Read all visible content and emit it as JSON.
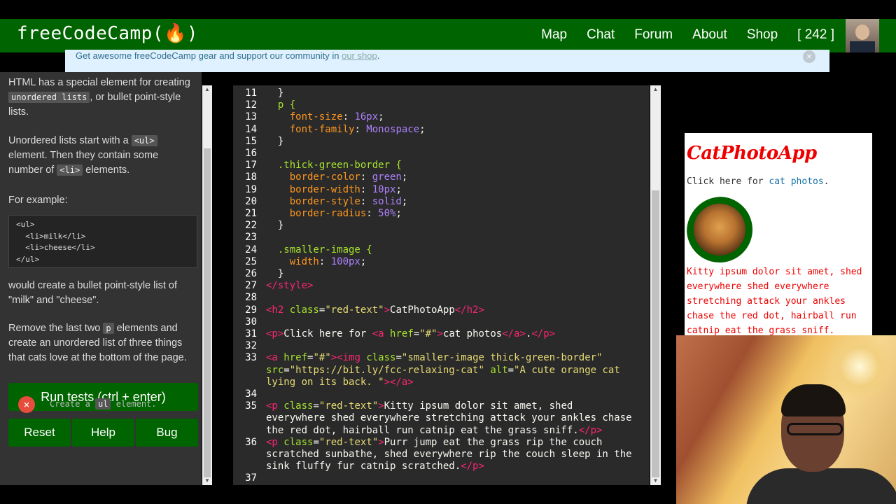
{
  "navbar": {
    "brand": "freeCodeCamp(🔥)",
    "links": [
      "Map",
      "Chat",
      "Forum",
      "About",
      "Shop"
    ],
    "points": "[ 242 ]"
  },
  "banner": {
    "text": "Get awesome freeCodeCamp gear and support our community in ",
    "link": "our shop",
    "suffix": ".",
    "close": "×"
  },
  "instructions": {
    "intro_pre": "HTML has a special element for creating ",
    "intro_code": "unordered lists",
    "intro_post": ", or bullet point-style lists.",
    "p2_pre": "Unordered lists start with a ",
    "p2_code1": "<ul>",
    "p2_mid": " element. Then they contain some number of ",
    "p2_code2": "<li>",
    "p2_post": " elements.",
    "p3": "For example:",
    "example_code": "<ul>\n  <li>milk</li>\n  <li>cheese</li>\n</ul>",
    "p4": "would create a bullet point-style list of \"milk\" and \"cheese\".",
    "p5_pre": "Remove the last two ",
    "p5_code": "p",
    "p5_post": " elements and create an unordered list of three things that cats love at the bottom of the page."
  },
  "buttons": {
    "run": "Run tests (ctrl + enter)",
    "reset": "Reset",
    "help": "Help",
    "bug": "Bug"
  },
  "test": {
    "status_icon": "×",
    "pre": "Create a ",
    "code": "ul",
    "post": " element."
  },
  "editor": {
    "line_numbers": [
      "11",
      "12",
      "13",
      "14",
      "15",
      "16",
      "17",
      "18",
      "19",
      "20",
      "21",
      "22",
      "23",
      "24",
      "25",
      "26",
      "27",
      "28",
      "29",
      "30",
      "31",
      "32",
      "33",
      "",
      "",
      "34",
      "35",
      "",
      "",
      "36",
      "",
      "",
      "37"
    ]
  },
  "preview": {
    "title": "CatPhotoApp",
    "p1_pre": "Click here for ",
    "p1_link": "cat photos",
    "p1_post": ".",
    "p2": "Kitty ipsum dolor sit amet, shed everywhere shed everywhere stretching attack your ankles chase the red dot, hairball run catnip eat the grass sniff."
  }
}
